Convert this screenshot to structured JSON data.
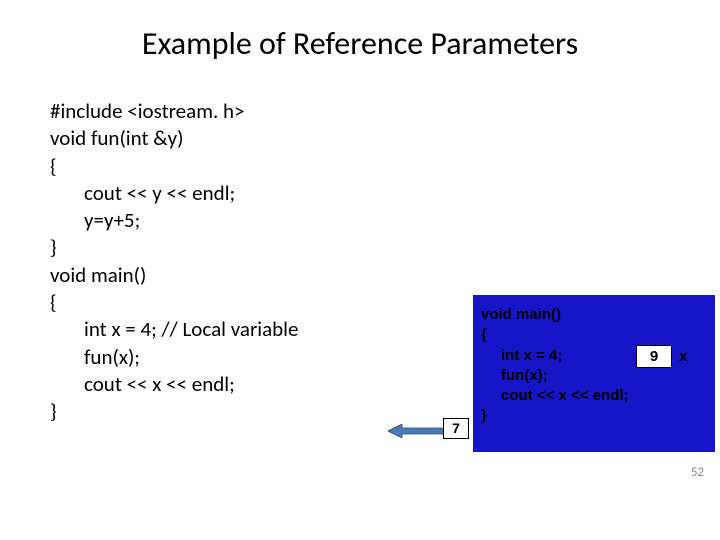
{
  "title": "Example of Reference Parameters",
  "code": {
    "l1": "#include <iostream. h>",
    "l2": "void fun(int &y)",
    "l3": "{",
    "l4": "cout << y << endl;",
    "l5": "y=y+5;",
    "l6": "}",
    "l7": "void main()",
    "l8": "{",
    "l9": "int x = 4; // Local variable",
    "l10": "fun(x);",
    "l11": "cout << x << endl;",
    "l12": "}"
  },
  "panel": {
    "l1": "void main()",
    "l2": "{",
    "l3": "int x = 4;",
    "l4": "fun(x);",
    "l5": "cout << x << endl;",
    "l6": "}"
  },
  "boxes": {
    "step": "7",
    "xval": "9",
    "xlabel": "x"
  },
  "slide_number": "52"
}
